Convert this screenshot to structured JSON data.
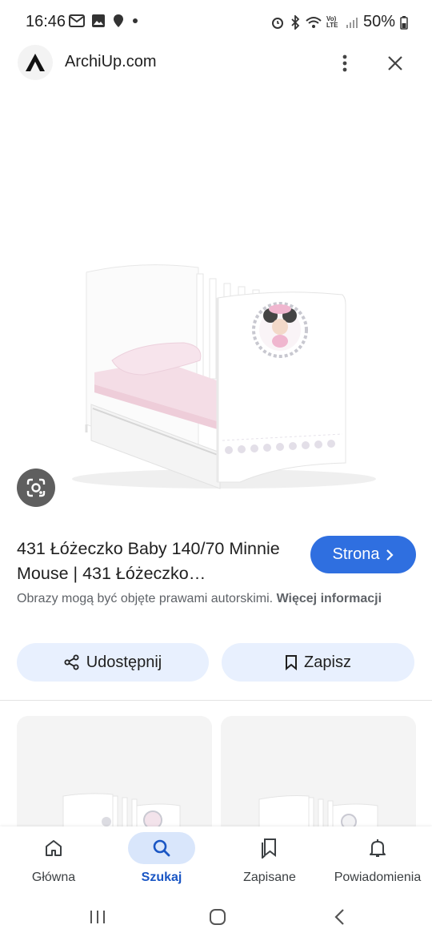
{
  "status": {
    "time": "16:46",
    "battery": "50%",
    "network": "Vo) LTE"
  },
  "header": {
    "site": "ArchiUp.com",
    "logo_icon": "archiup-logo-icon",
    "more_icon": "more-vert-icon",
    "close_icon": "close-icon"
  },
  "image": {
    "subject": "white crib with Minnie Mouse print",
    "lens_icon": "google-lens-icon"
  },
  "result": {
    "title": "431 Łóżeczko Baby 140/70 Minnie Mouse | 431 Łóżeczko…",
    "visit_label": "Strona",
    "copyright_text": "Obrazy mogą być objęte prawami autorskimi.",
    "copyright_more": "Więcej informacji"
  },
  "actions": {
    "share_label": "Udostępnij",
    "save_label": "Zapisz"
  },
  "nav": {
    "items": [
      {
        "label": "Główna",
        "icon": "home-icon",
        "active": false
      },
      {
        "label": "Szukaj",
        "icon": "search-icon",
        "active": true
      },
      {
        "label": "Zapisane",
        "icon": "saved-icon",
        "active": false
      },
      {
        "label": "Powiadomienia",
        "icon": "bell-icon",
        "active": false
      }
    ]
  },
  "colors": {
    "accent": "#2f6fe0",
    "tonal_button": "#e8f0fe",
    "active_nav": "#d9e6fb"
  }
}
